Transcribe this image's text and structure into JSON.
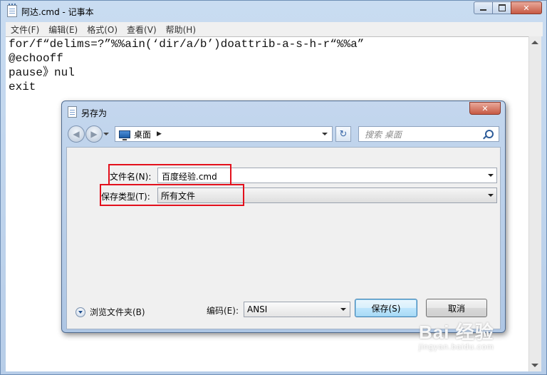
{
  "notepad": {
    "title": "阿达.cmd - 记事本",
    "menu": [
      "文件(F)",
      "编辑(E)",
      "格式(O)",
      "查看(V)",
      "帮助(H)"
    ],
    "lines": [
      "for/f“delims=?”%%ain(‘dir/a/b’)doattrib-a-s-h-r“%%a”",
      "@echooff",
      "pause》nul",
      "exit"
    ]
  },
  "dialog": {
    "title": "另存为",
    "address": "桌面",
    "search_placeholder": "搜索 桌面",
    "filename_label": "文件名(N):",
    "filename_value": "百度经验.cmd",
    "filetype_label": "保存类型(T):",
    "filetype_value": "所有文件",
    "browse_folders": "浏览文件夹(B)",
    "encoding_label": "编码(E):",
    "encoding_value": "ANSI",
    "save_label": "保存(S)",
    "cancel_label": "取消"
  },
  "watermark": {
    "logo": "Bai 经验",
    "url": "jingyan.baidu.com"
  },
  "colors": {
    "highlight_box": "#e3101c",
    "titlebar": "#c4d7ee"
  }
}
